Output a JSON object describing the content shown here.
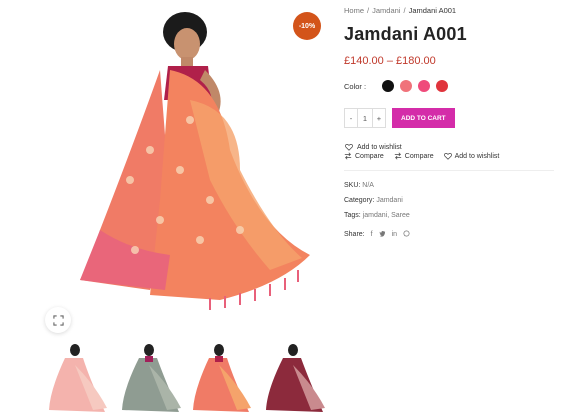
{
  "badge": {
    "text": "-10%"
  },
  "breadcrumb": {
    "home": "Home",
    "category": "Jamdani",
    "current": "Jamdani A001",
    "separator": "/"
  },
  "product": {
    "title": "Jamdani A001",
    "price": "£140.00 – £180.00",
    "color_label": "Color :",
    "swatches": [
      {
        "name": "black",
        "color": "#111111"
      },
      {
        "name": "salmon",
        "color": "#f0727a"
      },
      {
        "name": "pink",
        "color": "#ef4b7b"
      },
      {
        "name": "red",
        "color": "#e0343c"
      }
    ]
  },
  "cart": {
    "minus": "-",
    "quantity": "1",
    "plus": "+",
    "add_label": "ADD TO CART"
  },
  "actions": {
    "wishlist_top": "Add to wishlist",
    "compare_1": "Compare",
    "compare_2": "Compare",
    "wishlist_2": "Add to wishlist"
  },
  "meta": {
    "sku_label": "SKU:",
    "sku_value": "N/A",
    "category_label": "Category:",
    "category_value": "Jamdani",
    "tags_label": "Tags:",
    "tags_value": "jamdani, Saree",
    "share_label": "Share:"
  },
  "share_icons": [
    "f",
    "twitter",
    "in",
    "whatsapp"
  ],
  "colors": {
    "accent": "#d42ca9",
    "price": "#c0392b",
    "badge": "#d3541a"
  }
}
